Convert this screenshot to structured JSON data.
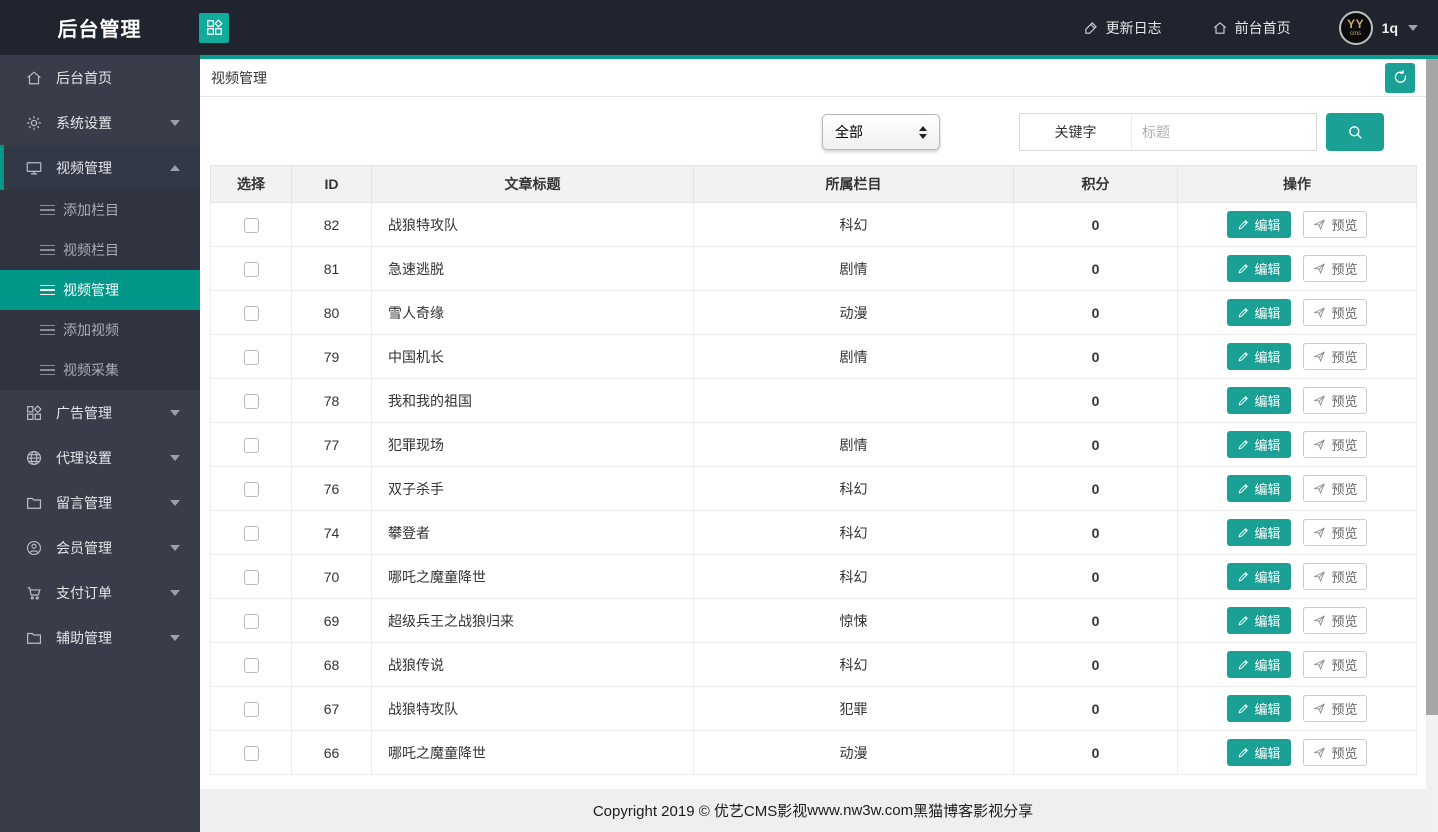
{
  "app": {
    "title": "后台管理"
  },
  "header": {
    "changelog": "更新日志",
    "frontend_home": "前台首页",
    "username": "1q",
    "avatar_top": "YY",
    "avatar_bottom": "cms"
  },
  "sidebar": {
    "items": [
      {
        "label": "后台首页"
      },
      {
        "label": "系统设置"
      },
      {
        "label": "视频管理"
      },
      {
        "label": "广告管理"
      },
      {
        "label": "代理设置"
      },
      {
        "label": "留言管理"
      },
      {
        "label": "会员管理"
      },
      {
        "label": "支付订单"
      },
      {
        "label": "辅助管理"
      }
    ],
    "video_submenu": [
      {
        "label": "添加栏目"
      },
      {
        "label": "视频栏目"
      },
      {
        "label": "视频管理",
        "active": true
      },
      {
        "label": "添加视频"
      },
      {
        "label": "视频采集"
      }
    ]
  },
  "page": {
    "title": "视频管理"
  },
  "filters": {
    "category_selected": "全部",
    "keyword_label": "关键字",
    "keyword_placeholder": "标题",
    "keyword_value": ""
  },
  "table": {
    "columns": [
      "选择",
      "ID",
      "文章标题",
      "所属栏目",
      "积分",
      "操作"
    ],
    "actions": {
      "edit": "编辑",
      "preview": "预览"
    },
    "rows": [
      {
        "id": 82,
        "title": "战狼特攻队",
        "category": "科幻",
        "score": 0
      },
      {
        "id": 81,
        "title": "急速逃脱",
        "category": "剧情",
        "score": 0
      },
      {
        "id": 80,
        "title": "雪人奇缘",
        "category": "动漫",
        "score": 0
      },
      {
        "id": 79,
        "title": "中国机长",
        "category": "剧情",
        "score": 0
      },
      {
        "id": 78,
        "title": "我和我的祖国",
        "category": "",
        "score": 0
      },
      {
        "id": 77,
        "title": "犯罪现场",
        "category": "剧情",
        "score": 0
      },
      {
        "id": 76,
        "title": "双子杀手",
        "category": "科幻",
        "score": 0
      },
      {
        "id": 74,
        "title": "攀登者",
        "category": "科幻",
        "score": 0
      },
      {
        "id": 70,
        "title": "哪吒之魔童降世",
        "category": "科幻",
        "score": 0
      },
      {
        "id": 69,
        "title": "超级兵王之战狼归来",
        "category": "惊悚",
        "score": 0
      },
      {
        "id": 68,
        "title": "战狼传说",
        "category": "科幻",
        "score": 0
      },
      {
        "id": 67,
        "title": "战狼特攻队",
        "category": "犯罪",
        "score": 0
      },
      {
        "id": 66,
        "title": "哪吒之魔童降世",
        "category": "动漫",
        "score": 0
      }
    ]
  },
  "footer": {
    "prefix": "Copyright 2019 © 优艺CMS影视",
    "link": "www.nw3w.com",
    "suffix": "黑猫博客影视分享"
  },
  "colors": {
    "accent": "#009688",
    "button_teal": "#1aa094",
    "header_bg": "#20242e",
    "sidebar_bg": "#393d49"
  }
}
